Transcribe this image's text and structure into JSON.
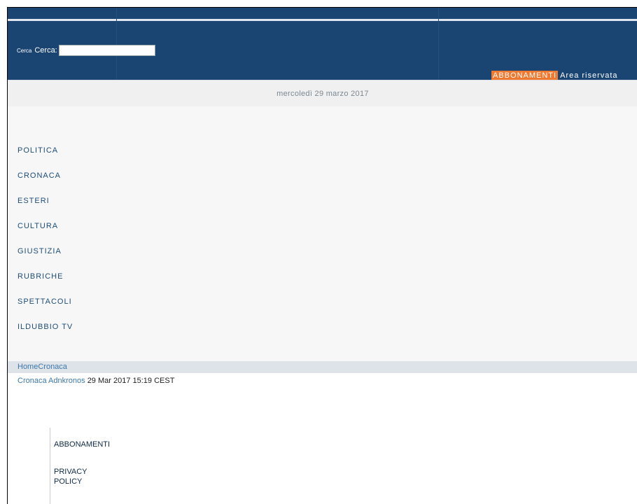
{
  "search": {
    "tiny_label": "Cerca",
    "label": "Cerca:",
    "value": ""
  },
  "top_links": {
    "subscriptions": "ABBONAMENTI",
    "reserved_area": "Area riservata"
  },
  "date_bar": {
    "text": "mercoledì 29 marzo 2017"
  },
  "nav": {
    "items": [
      {
        "label": "POLITICA"
      },
      {
        "label": "CRONACA"
      },
      {
        "label": "ESTERI"
      },
      {
        "label": "CULTURA"
      },
      {
        "label": "GIUSTIZIA"
      },
      {
        "label": "RUBRICHE"
      },
      {
        "label": "SPETTACOLI"
      },
      {
        "label": "ILDUBBIO TV"
      }
    ]
  },
  "breadcrumb": {
    "home": "Home",
    "section": "Cronaca"
  },
  "article_meta": {
    "category": "Cronaca",
    "source": "Adnkronos",
    "published": "29 Mar 2017 15:19 CEST"
  },
  "footer_links": {
    "subscriptions": "ABBONAMENTI",
    "privacy": "PRIVACY POLICY"
  },
  "colors": {
    "header": "#1a4472",
    "accent": "#f0782f",
    "link": "#3d78aa",
    "nav_text": "#1f4d77"
  }
}
